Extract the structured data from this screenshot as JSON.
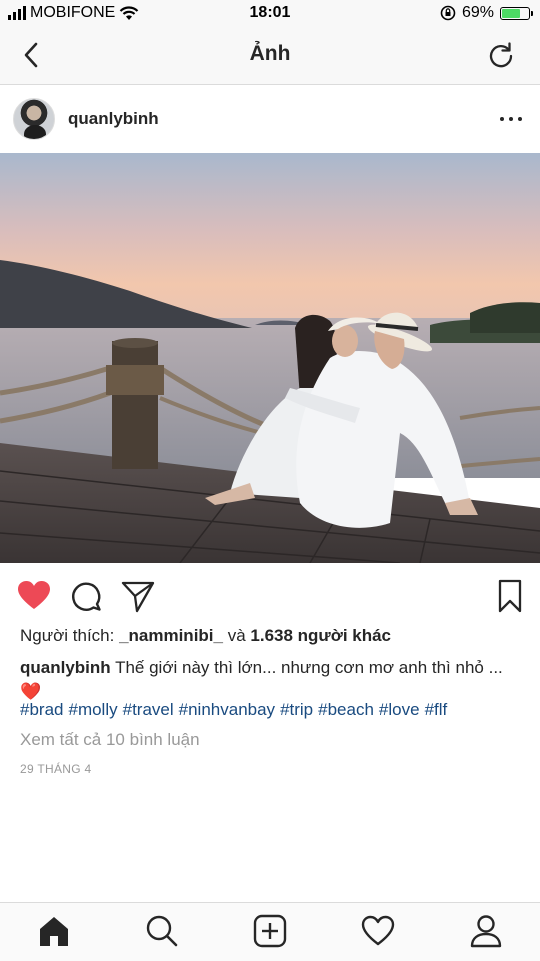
{
  "status_bar": {
    "carrier": "MOBIFONE",
    "time": "18:01",
    "battery_percent": "69%",
    "battery_level": 0.69,
    "battery_color": "#4cd964"
  },
  "nav": {
    "title": "Ảnh",
    "back_icon": "chevron-left-icon",
    "refresh_icon": "refresh-icon"
  },
  "post": {
    "username": "quanlybinh",
    "likes_prefix": "Người thích: ",
    "likes_user": "_namminibi_",
    "likes_middle": " và ",
    "likes_count": "1.638 người khác",
    "caption_user": "quanlybinh",
    "caption_text": " Thế giới này thì lớn... nhưng cơn mơ anh thì nhỏ ... ❤️",
    "hashtags": [
      "#brad",
      "#molly",
      "#travel",
      "#ninhvanbay",
      "#trip",
      "#beach",
      "#love",
      "#flf"
    ],
    "comments_link": "Xem tất cả 10 bình luận",
    "date": "29 THÁNG 4",
    "liked": true,
    "heart_color": "#ed4956",
    "hashtag_color": "#1a4b80"
  },
  "tabs": [
    {
      "name": "home",
      "icon": "home-icon",
      "active": true
    },
    {
      "name": "search",
      "icon": "search-icon",
      "active": false
    },
    {
      "name": "new-post",
      "icon": "plus-square-icon",
      "active": false
    },
    {
      "name": "activity",
      "icon": "heart-icon",
      "active": false
    },
    {
      "name": "profile",
      "icon": "profile-icon",
      "active": false
    }
  ]
}
